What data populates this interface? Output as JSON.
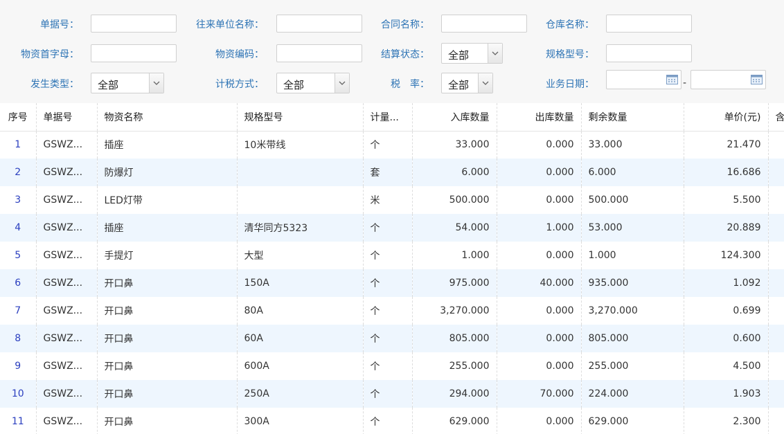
{
  "filters": {
    "doc_no": {
      "label": "单据号：",
      "value": ""
    },
    "partner": {
      "label": "往来单位名称：",
      "value": ""
    },
    "contract": {
      "label": "合同名称：",
      "value": ""
    },
    "warehouse": {
      "label": "仓库名称：",
      "value": ""
    },
    "initial": {
      "label": "物资首字母：",
      "value": ""
    },
    "material_code": {
      "label": "物资编码：",
      "value": ""
    },
    "settle_status": {
      "label": "结算状态：",
      "value": "全部"
    },
    "spec": {
      "label": "规格型号：",
      "value": ""
    },
    "occur_type": {
      "label": "发生类型：",
      "value": "全部"
    },
    "tax_method": {
      "label": "计税方式：",
      "value": "全部"
    },
    "tax_rate": {
      "label": "税　率：",
      "value": "全部"
    },
    "biz_date": {
      "label": "业务日期：",
      "from": "",
      "to": "",
      "separator": "-"
    }
  },
  "table": {
    "headers": [
      "序号",
      "单据号",
      "物资名称",
      "规格型号",
      "计量...",
      "入库数量",
      "出库数量",
      "剩余数量",
      "单价(元)",
      "含"
    ],
    "rows": [
      [
        "1",
        "GSWZ...",
        "插座",
        "10米带线",
        "个",
        "33.000",
        "0.000",
        "33.000",
        "21.470"
      ],
      [
        "2",
        "GSWZ...",
        "防爆灯",
        "",
        "套",
        "6.000",
        "0.000",
        "6.000",
        "16.686"
      ],
      [
        "3",
        "GSWZ...",
        "LED灯带",
        "",
        "米",
        "500.000",
        "0.000",
        "500.000",
        "5.500"
      ],
      [
        "4",
        "GSWZ...",
        "插座",
        "清华同方5323",
        "个",
        "54.000",
        "1.000",
        "53.000",
        "20.889"
      ],
      [
        "5",
        "GSWZ...",
        "手提灯",
        "大型",
        "个",
        "1.000",
        "0.000",
        "1.000",
        "124.300"
      ],
      [
        "6",
        "GSWZ...",
        "开口鼻",
        "150A",
        "个",
        "975.000",
        "40.000",
        "935.000",
        "1.092"
      ],
      [
        "7",
        "GSWZ...",
        "开口鼻",
        "80A",
        "个",
        "3,270.000",
        "0.000",
        "3,270.000",
        "0.699"
      ],
      [
        "8",
        "GSWZ...",
        "开口鼻",
        "60A",
        "个",
        "805.000",
        "0.000",
        "805.000",
        "0.600"
      ],
      [
        "9",
        "GSWZ...",
        "开口鼻",
        "600A",
        "个",
        "255.000",
        "0.000",
        "255.000",
        "4.500"
      ],
      [
        "10",
        "GSWZ...",
        "开口鼻",
        "250A",
        "个",
        "294.000",
        "70.000",
        "224.000",
        "1.903"
      ],
      [
        "11",
        "GSWZ...",
        "开口鼻",
        "300A",
        "个",
        "629.000",
        "0.000",
        "629.000",
        "2.300"
      ]
    ]
  },
  "icons": {
    "calendar": "calendar-icon",
    "dropdown": "chevron-down-icon"
  }
}
